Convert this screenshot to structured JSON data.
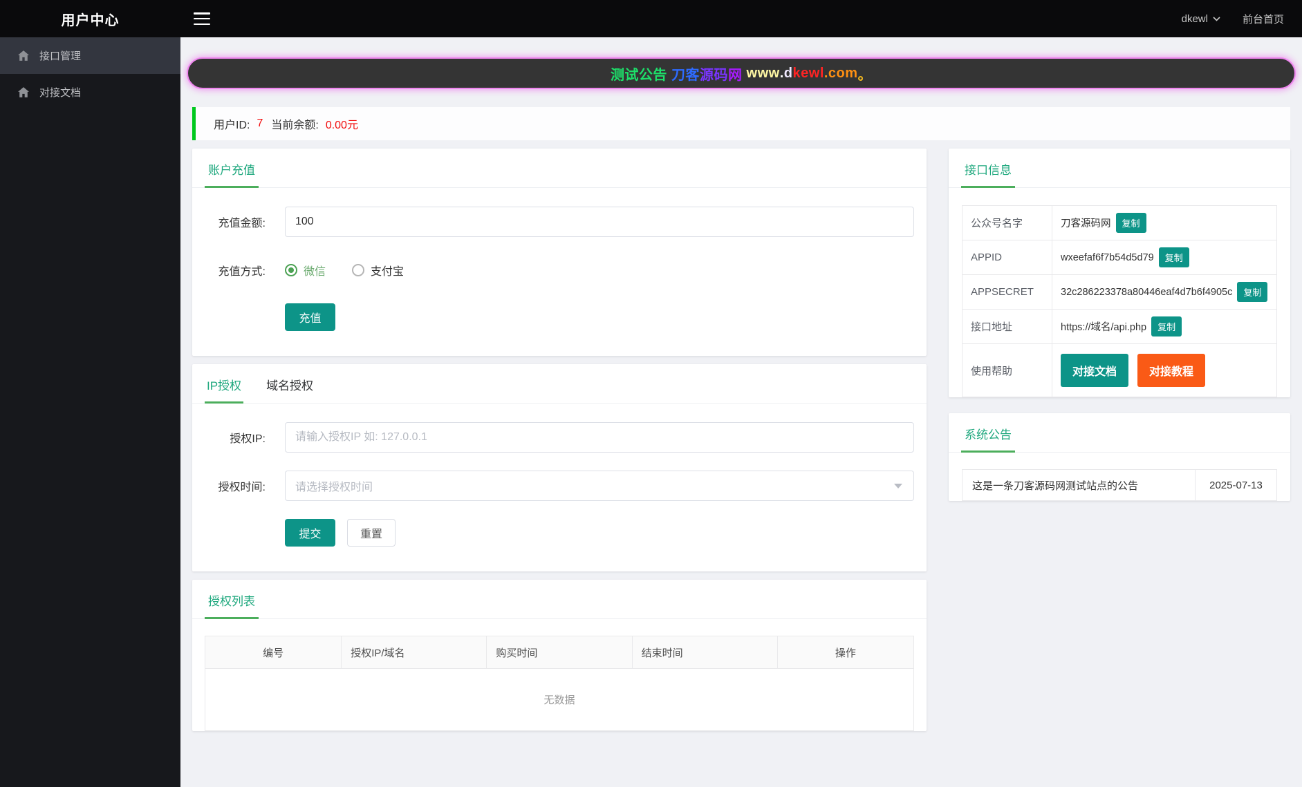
{
  "header": {
    "app_title": "用户中心",
    "username": "dkewl",
    "frontend_link": "前台首页"
  },
  "sidebar": {
    "items": [
      {
        "label": "接口管理",
        "active": true
      },
      {
        "label": "对接文档",
        "active": false
      }
    ]
  },
  "banner": {
    "segments": [
      {
        "text": "测试公告",
        "color": "#1de06a"
      },
      {
        "text": " 刀客",
        "color": "#2e6bff"
      },
      {
        "text": "源码",
        "color": "#7a35ff"
      },
      {
        "text": "网",
        "color": "#a81aff"
      },
      {
        "text": " www",
        "color": "#fdf6a3"
      },
      {
        "text": ".",
        "color": "#ffffff"
      },
      {
        "text": "d",
        "color": "#efe8ff"
      },
      {
        "text": "kewl",
        "color": "#ff2424"
      },
      {
        "text": ".com",
        "color": "#ff9012"
      },
      {
        "text": "。",
        "color": "#ffc01e"
      }
    ]
  },
  "user_bar": {
    "id_label": "用户ID:",
    "id_value": "7",
    "balance_label": "当前余额:",
    "balance_value": "0.00元"
  },
  "recharge": {
    "title": "账户充值",
    "amount_label": "充值金额:",
    "amount_value": "100",
    "method_label": "充值方式:",
    "method_wechat": "微信",
    "method_alipay": "支付宝",
    "submit_label": "充值"
  },
  "auth": {
    "tab_ip": "IP授权",
    "tab_domain": "域名授权",
    "ip_label": "授权IP:",
    "ip_placeholder": "请输入授权IP 如: 127.0.0.1",
    "time_label": "授权时间:",
    "time_placeholder": "请选择授权时间",
    "submit_label": "提交",
    "reset_label": "重置"
  },
  "auth_list": {
    "title": "授权列表",
    "columns": [
      "编号",
      "授权IP/域名",
      "购买时间",
      "结束时间",
      "操作"
    ],
    "empty_text": "无数据"
  },
  "api_info": {
    "title": "接口信息",
    "copy_label": "复制",
    "rows": [
      {
        "label": "公众号名字",
        "value": "刀客源码网"
      },
      {
        "label": "APPID",
        "value": "wxeefaf6f7b54d5d79"
      },
      {
        "label": "APPSECRET",
        "value": "32c286223378a80446eaf4d7b6f4905c"
      },
      {
        "label": "接口地址",
        "value": "https://域名/api.php"
      }
    ],
    "help_label": "使用帮助",
    "help_doc": "对接文档",
    "help_tutorial": "对接教程"
  },
  "notice": {
    "title": "系统公告",
    "text": "这是一条刀客源码网测试站点的公告",
    "date": "2025-07-13"
  },
  "colors": {
    "teal": "#0d9488",
    "orange": "#fa5a16",
    "title_teal": "#1fa87e",
    "underline_green": "#4cae5c",
    "bar_green": "#00c81e",
    "alert_red": "#f20d0d",
    "banner_border_pink": "#ee86ee"
  }
}
